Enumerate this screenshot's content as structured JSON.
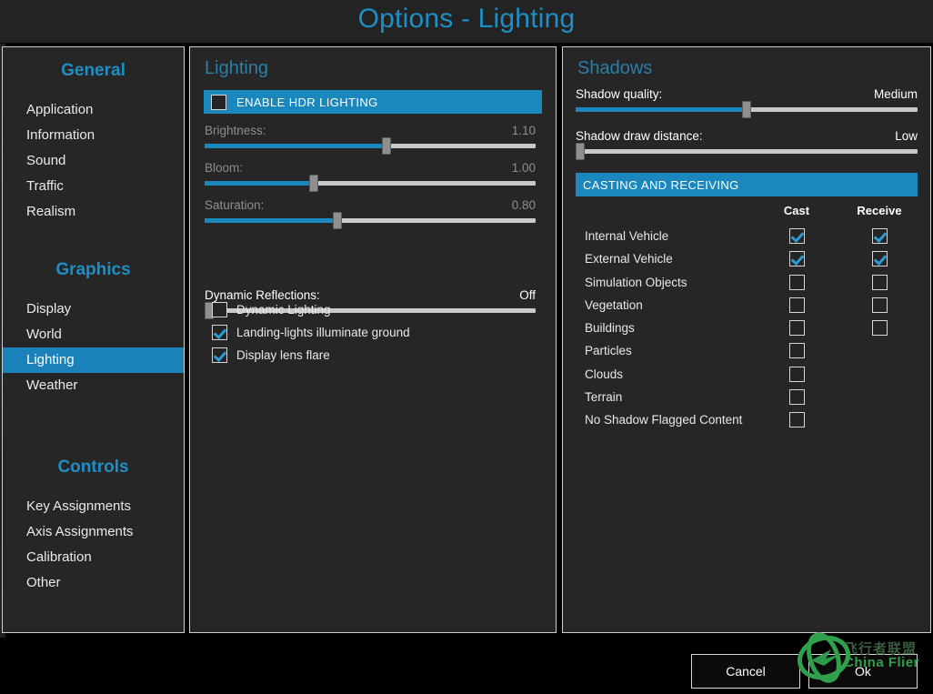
{
  "window": {
    "title": "Options - Lighting",
    "accent_blue": "#1a87bd",
    "title_blue": "#1e8ec4",
    "panel_bg": "#262626",
    "panel_border": "#cfcfcf",
    "page_bg": "#000000"
  },
  "sidebar": {
    "groups": [
      {
        "title": "General",
        "items": [
          {
            "label": "Application",
            "selected": false
          },
          {
            "label": "Information",
            "selected": false
          },
          {
            "label": "Sound",
            "selected": false
          },
          {
            "label": "Traffic",
            "selected": false
          },
          {
            "label": "Realism",
            "selected": false
          }
        ]
      },
      {
        "title": "Graphics",
        "items": [
          {
            "label": "Display",
            "selected": false
          },
          {
            "label": "World",
            "selected": false
          },
          {
            "label": "Lighting",
            "selected": true
          },
          {
            "label": "Weather",
            "selected": false
          }
        ]
      },
      {
        "title": "Controls",
        "items": [
          {
            "label": "Key Assignments",
            "selected": false
          },
          {
            "label": "Axis Assignments",
            "selected": false
          },
          {
            "label": "Calibration",
            "selected": false
          },
          {
            "label": "Other",
            "selected": false
          }
        ]
      }
    ]
  },
  "lighting": {
    "section_title": "Lighting",
    "hdr_band": {
      "label": "ENABLE HDR LIGHTING",
      "checked": false
    },
    "sliders": [
      {
        "label": "Brightness:",
        "value": "1.10",
        "percent": 55,
        "dim": true
      },
      {
        "label": "Bloom:",
        "value": "1.00",
        "percent": 33,
        "dim": true
      },
      {
        "label": "Saturation:",
        "value": "0.80",
        "percent": 40,
        "dim": true
      },
      {
        "label": "Dynamic Reflections:",
        "value": "Off",
        "percent": 0,
        "dim": false
      }
    ],
    "checkboxes": [
      {
        "label": "Dynamic Lighting",
        "checked": false
      },
      {
        "label": "Landing-lights illuminate ground",
        "checked": true
      },
      {
        "label": "Display lens flare",
        "checked": true
      }
    ]
  },
  "shadows": {
    "section_title": "Shadows",
    "sliders": [
      {
        "label": "Shadow quality:",
        "value": "Medium",
        "percent": 50
      },
      {
        "label": "Shadow draw distance:",
        "value": "Low",
        "percent": 0
      }
    ],
    "band_label": "CASTING AND RECEIVING",
    "columns": {
      "cast": "Cast",
      "receive": "Receive"
    },
    "rows": [
      {
        "label": "Internal Vehicle",
        "cast": true,
        "cast_shown": true,
        "receive": true,
        "receive_shown": true
      },
      {
        "label": "External Vehicle",
        "cast": true,
        "cast_shown": true,
        "receive": true,
        "receive_shown": true
      },
      {
        "label": "Simulation Objects",
        "cast": false,
        "cast_shown": true,
        "receive": false,
        "receive_shown": true
      },
      {
        "label": "Vegetation",
        "cast": false,
        "cast_shown": true,
        "receive": false,
        "receive_shown": true
      },
      {
        "label": "Buildings",
        "cast": false,
        "cast_shown": true,
        "receive": false,
        "receive_shown": true
      },
      {
        "label": "Particles",
        "cast": false,
        "cast_shown": true,
        "receive": false,
        "receive_shown": false
      },
      {
        "label": "Clouds",
        "cast": false,
        "cast_shown": true,
        "receive": false,
        "receive_shown": false
      },
      {
        "label": "Terrain",
        "cast": false,
        "cast_shown": true,
        "receive": false,
        "receive_shown": false
      },
      {
        "label": "No Shadow Flagged Content",
        "cast": false,
        "cast_shown": true,
        "receive": false,
        "receive_shown": false
      }
    ]
  },
  "footer": {
    "cancel_label": "Cancel",
    "ok_label": "Ok"
  },
  "watermark": {
    "chinese": "飞行者联盟",
    "english": "China Flier",
    "ring_color": "#2fa04b"
  }
}
